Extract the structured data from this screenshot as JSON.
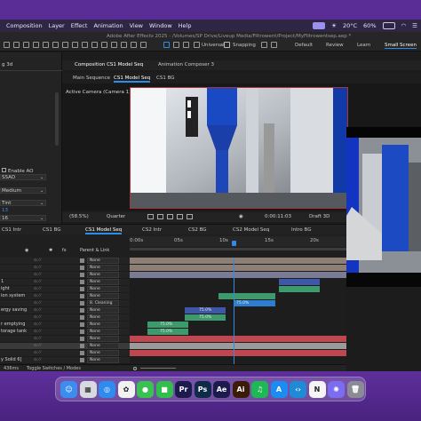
{
  "menubar": {
    "items": [
      "Composition",
      "Layer",
      "Effect",
      "Animation",
      "View",
      "Window",
      "Help"
    ],
    "weather": "20°C",
    "battery": "60%"
  },
  "window": {
    "title": "Adobe After Effects 2025 - /Volumes/SP Drive/Liveup Media/Filtrowent/Project/MyFiltrowentsep.aep *"
  },
  "toolbar": {
    "universal": "Universal",
    "snapping": "Snapping",
    "workspaces": [
      "Default",
      "Review",
      "Learn",
      "Small Screen"
    ]
  },
  "left_panel": {
    "partial_header": "g 3d",
    "rows": [
      "Enable AO",
      "SSAO",
      "Medium",
      "Tint",
      "13",
      "16"
    ]
  },
  "composition_panel": {
    "tab_title": "Composition CS1 Model Seq",
    "other_tab": "Animation Composer 3",
    "breadcrumbs": [
      "Main Sequence",
      "CS1 Model Seq",
      "CS1 BG"
    ],
    "active_camera": "Active Camera (Camera 1)",
    "footer": {
      "zoom": "(58.5%)",
      "resolution": "Quarter",
      "timecode": "0:00:11:03",
      "renderer": "Draft 3D"
    }
  },
  "timeline": {
    "tabs": [
      "CS1 Intr",
      "CS1 BG",
      "CS1 Model Seq",
      "CS2 Intr",
      "CS2 BG",
      "CS2 Model Seq",
      "Intro BG"
    ],
    "ruler": [
      "0:00s",
      "05s",
      "10s",
      "15s",
      "20s"
    ],
    "column_header": "Parent & Link",
    "layers": [
      {
        "name": "",
        "parent": "None"
      },
      {
        "name": "",
        "parent": "None"
      },
      {
        "name": "",
        "parent": "None"
      },
      {
        "name": "1",
        "parent": "None"
      },
      {
        "name": "ight",
        "parent": "None"
      },
      {
        "name": "ion system",
        "parent": "None"
      },
      {
        "name": "",
        "parent": "8. Cleaning"
      },
      {
        "name": "ergy saving",
        "parent": "None"
      },
      {
        "name": "",
        "parent": "None"
      },
      {
        "name": "r emptying",
        "parent": "None"
      },
      {
        "name": "torage tank",
        "parent": "None"
      },
      {
        "name": "",
        "parent": "None"
      },
      {
        "name": "",
        "parent": "None"
      },
      {
        "name": "",
        "parent": "None"
      },
      {
        "name": "y Solid 6]",
        "parent": "None"
      }
    ],
    "bar_labels": [
      "75.0%",
      "75.0%",
      "75.0%",
      "75.0%",
      "75.0%"
    ],
    "footer_left": "436ms",
    "footer_toggle": "Toggle Switches / Modes"
  },
  "dock": {
    "apps": [
      {
        "name": "finder",
        "glyph": "☺",
        "color": "#3b8ef0"
      },
      {
        "name": "launchpad",
        "glyph": "▦",
        "color": "#d9d9e0"
      },
      {
        "name": "safari",
        "glyph": "◎",
        "color": "#2e8bf0"
      },
      {
        "name": "photos",
        "glyph": "✿",
        "color": "#f2f2f2"
      },
      {
        "name": "messages",
        "glyph": "●",
        "color": "#39c24f"
      },
      {
        "name": "facetime",
        "glyph": "■",
        "color": "#2fbf4a"
      },
      {
        "name": "premiere",
        "glyph": "Pr",
        "color": "#1d1a4d"
      },
      {
        "name": "photoshop",
        "glyph": "Ps",
        "color": "#0f2b4a"
      },
      {
        "name": "after-effects",
        "glyph": "Ae",
        "color": "#1d1a4d"
      },
      {
        "name": "illustrator",
        "glyph": "Ai",
        "color": "#3a1c08"
      },
      {
        "name": "spotify",
        "glyph": "♫",
        "color": "#1db954"
      },
      {
        "name": "app-store",
        "glyph": "A",
        "color": "#1b8cf2"
      },
      {
        "name": "vscode",
        "glyph": "‹›",
        "color": "#1f8ad6"
      },
      {
        "name": "notion",
        "glyph": "N",
        "color": "#f5f5f5"
      },
      {
        "name": "settings",
        "glyph": "✺",
        "color": "#7b6cf0"
      },
      {
        "name": "trash",
        "glyph": "🗑",
        "color": "#8b8b95"
      }
    ]
  }
}
